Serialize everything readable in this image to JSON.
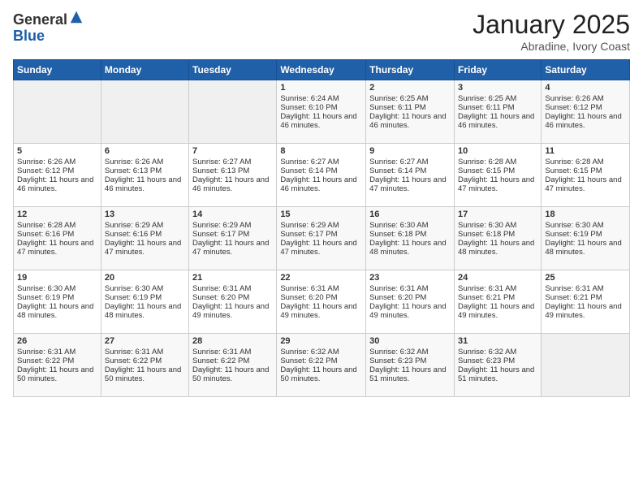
{
  "logo": {
    "general": "General",
    "blue": "Blue"
  },
  "header": {
    "month": "January 2025",
    "location": "Abradine, Ivory Coast"
  },
  "days_of_week": [
    "Sunday",
    "Monday",
    "Tuesday",
    "Wednesday",
    "Thursday",
    "Friday",
    "Saturday"
  ],
  "weeks": [
    [
      {
        "num": "",
        "sunrise": "",
        "sunset": "",
        "daylight": ""
      },
      {
        "num": "",
        "sunrise": "",
        "sunset": "",
        "daylight": ""
      },
      {
        "num": "",
        "sunrise": "",
        "sunset": "",
        "daylight": ""
      },
      {
        "num": "1",
        "sunrise": "Sunrise: 6:24 AM",
        "sunset": "Sunset: 6:10 PM",
        "daylight": "Daylight: 11 hours and 46 minutes."
      },
      {
        "num": "2",
        "sunrise": "Sunrise: 6:25 AM",
        "sunset": "Sunset: 6:11 PM",
        "daylight": "Daylight: 11 hours and 46 minutes."
      },
      {
        "num": "3",
        "sunrise": "Sunrise: 6:25 AM",
        "sunset": "Sunset: 6:11 PM",
        "daylight": "Daylight: 11 hours and 46 minutes."
      },
      {
        "num": "4",
        "sunrise": "Sunrise: 6:26 AM",
        "sunset": "Sunset: 6:12 PM",
        "daylight": "Daylight: 11 hours and 46 minutes."
      }
    ],
    [
      {
        "num": "5",
        "sunrise": "Sunrise: 6:26 AM",
        "sunset": "Sunset: 6:12 PM",
        "daylight": "Daylight: 11 hours and 46 minutes."
      },
      {
        "num": "6",
        "sunrise": "Sunrise: 6:26 AM",
        "sunset": "Sunset: 6:13 PM",
        "daylight": "Daylight: 11 hours and 46 minutes."
      },
      {
        "num": "7",
        "sunrise": "Sunrise: 6:27 AM",
        "sunset": "Sunset: 6:13 PM",
        "daylight": "Daylight: 11 hours and 46 minutes."
      },
      {
        "num": "8",
        "sunrise": "Sunrise: 6:27 AM",
        "sunset": "Sunset: 6:14 PM",
        "daylight": "Daylight: 11 hours and 46 minutes."
      },
      {
        "num": "9",
        "sunrise": "Sunrise: 6:27 AM",
        "sunset": "Sunset: 6:14 PM",
        "daylight": "Daylight: 11 hours and 47 minutes."
      },
      {
        "num": "10",
        "sunrise": "Sunrise: 6:28 AM",
        "sunset": "Sunset: 6:15 PM",
        "daylight": "Daylight: 11 hours and 47 minutes."
      },
      {
        "num": "11",
        "sunrise": "Sunrise: 6:28 AM",
        "sunset": "Sunset: 6:15 PM",
        "daylight": "Daylight: 11 hours and 47 minutes."
      }
    ],
    [
      {
        "num": "12",
        "sunrise": "Sunrise: 6:28 AM",
        "sunset": "Sunset: 6:16 PM",
        "daylight": "Daylight: 11 hours and 47 minutes."
      },
      {
        "num": "13",
        "sunrise": "Sunrise: 6:29 AM",
        "sunset": "Sunset: 6:16 PM",
        "daylight": "Daylight: 11 hours and 47 minutes."
      },
      {
        "num": "14",
        "sunrise": "Sunrise: 6:29 AM",
        "sunset": "Sunset: 6:17 PM",
        "daylight": "Daylight: 11 hours and 47 minutes."
      },
      {
        "num": "15",
        "sunrise": "Sunrise: 6:29 AM",
        "sunset": "Sunset: 6:17 PM",
        "daylight": "Daylight: 11 hours and 47 minutes."
      },
      {
        "num": "16",
        "sunrise": "Sunrise: 6:30 AM",
        "sunset": "Sunset: 6:18 PM",
        "daylight": "Daylight: 11 hours and 48 minutes."
      },
      {
        "num": "17",
        "sunrise": "Sunrise: 6:30 AM",
        "sunset": "Sunset: 6:18 PM",
        "daylight": "Daylight: 11 hours and 48 minutes."
      },
      {
        "num": "18",
        "sunrise": "Sunrise: 6:30 AM",
        "sunset": "Sunset: 6:19 PM",
        "daylight": "Daylight: 11 hours and 48 minutes."
      }
    ],
    [
      {
        "num": "19",
        "sunrise": "Sunrise: 6:30 AM",
        "sunset": "Sunset: 6:19 PM",
        "daylight": "Daylight: 11 hours and 48 minutes."
      },
      {
        "num": "20",
        "sunrise": "Sunrise: 6:30 AM",
        "sunset": "Sunset: 6:19 PM",
        "daylight": "Daylight: 11 hours and 48 minutes."
      },
      {
        "num": "21",
        "sunrise": "Sunrise: 6:31 AM",
        "sunset": "Sunset: 6:20 PM",
        "daylight": "Daylight: 11 hours and 49 minutes."
      },
      {
        "num": "22",
        "sunrise": "Sunrise: 6:31 AM",
        "sunset": "Sunset: 6:20 PM",
        "daylight": "Daylight: 11 hours and 49 minutes."
      },
      {
        "num": "23",
        "sunrise": "Sunrise: 6:31 AM",
        "sunset": "Sunset: 6:20 PM",
        "daylight": "Daylight: 11 hours and 49 minutes."
      },
      {
        "num": "24",
        "sunrise": "Sunrise: 6:31 AM",
        "sunset": "Sunset: 6:21 PM",
        "daylight": "Daylight: 11 hours and 49 minutes."
      },
      {
        "num": "25",
        "sunrise": "Sunrise: 6:31 AM",
        "sunset": "Sunset: 6:21 PM",
        "daylight": "Daylight: 11 hours and 49 minutes."
      }
    ],
    [
      {
        "num": "26",
        "sunrise": "Sunrise: 6:31 AM",
        "sunset": "Sunset: 6:22 PM",
        "daylight": "Daylight: 11 hours and 50 minutes."
      },
      {
        "num": "27",
        "sunrise": "Sunrise: 6:31 AM",
        "sunset": "Sunset: 6:22 PM",
        "daylight": "Daylight: 11 hours and 50 minutes."
      },
      {
        "num": "28",
        "sunrise": "Sunrise: 6:31 AM",
        "sunset": "Sunset: 6:22 PM",
        "daylight": "Daylight: 11 hours and 50 minutes."
      },
      {
        "num": "29",
        "sunrise": "Sunrise: 6:32 AM",
        "sunset": "Sunset: 6:22 PM",
        "daylight": "Daylight: 11 hours and 50 minutes."
      },
      {
        "num": "30",
        "sunrise": "Sunrise: 6:32 AM",
        "sunset": "Sunset: 6:23 PM",
        "daylight": "Daylight: 11 hours and 51 minutes."
      },
      {
        "num": "31",
        "sunrise": "Sunrise: 6:32 AM",
        "sunset": "Sunset: 6:23 PM",
        "daylight": "Daylight: 11 hours and 51 minutes."
      },
      {
        "num": "",
        "sunrise": "",
        "sunset": "",
        "daylight": ""
      }
    ]
  ]
}
